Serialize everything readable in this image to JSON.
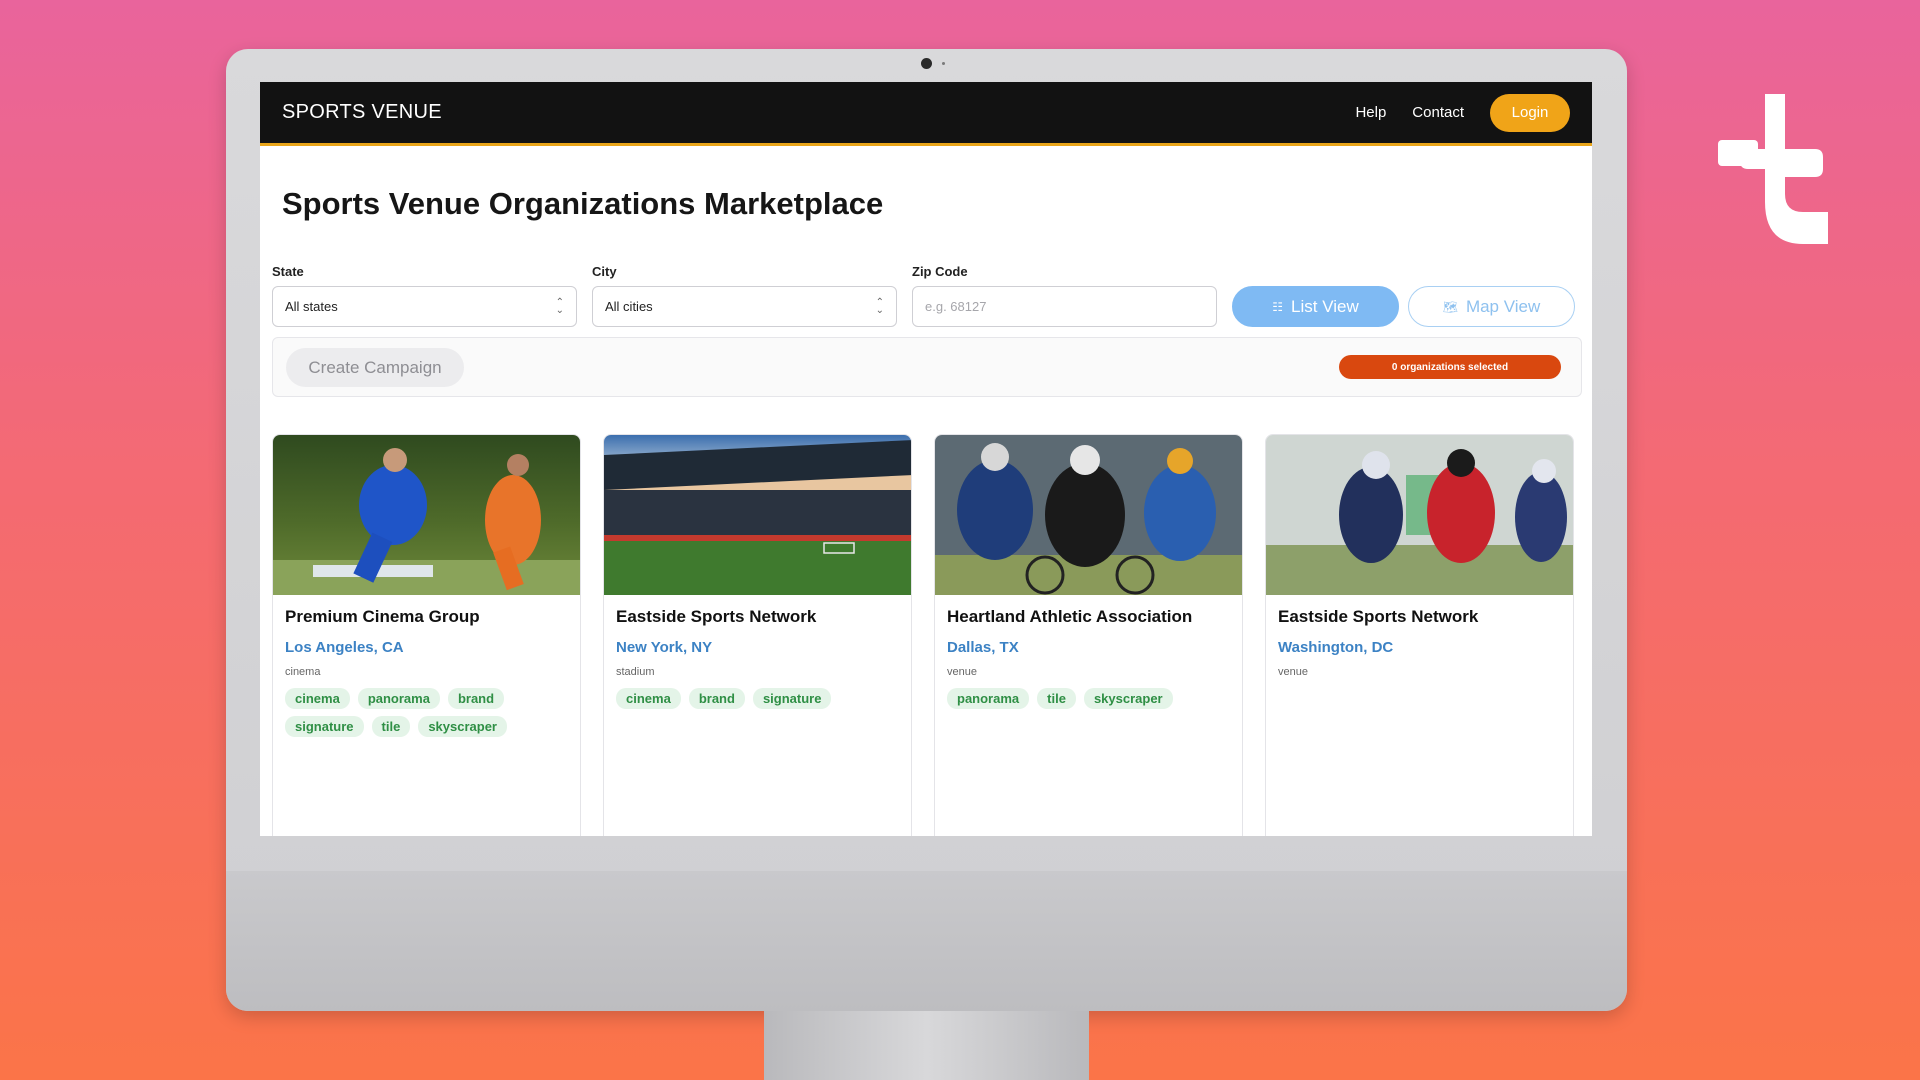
{
  "navbar": {
    "logo": "SPORTS VENUE",
    "links": [
      "Help",
      "Contact"
    ],
    "login": "Login"
  },
  "page": {
    "title": "Sports Venue Organizations Marketplace"
  },
  "filters": {
    "state_label": "State",
    "state_value": "All states",
    "city_label": "City",
    "city_value": "All cities",
    "zip_label": "Zip Code",
    "zip_placeholder": "e.g. 68127",
    "list_view": "List View",
    "map_view": "Map View"
  },
  "campaign": {
    "create_label": "Create Campaign",
    "selected_text": "0 organizations selected"
  },
  "cards": [
    {
      "title": "Premium Cinema Group",
      "location": "Los Angeles, CA",
      "category": "cinema",
      "tags": [
        "cinema",
        "panorama",
        "brand",
        "signature",
        "tile",
        "skyscraper"
      ],
      "image": "soccer-players"
    },
    {
      "title": "Eastside Sports Network",
      "location": "New York, NY",
      "category": "stadium",
      "tags": [
        "cinema",
        "brand",
        "signature"
      ],
      "image": "stadium"
    },
    {
      "title": "Heartland Athletic Association",
      "location": "Dallas, TX",
      "category": "venue",
      "tags": [
        "panorama",
        "tile",
        "skyscraper"
      ],
      "image": "cyclists"
    },
    {
      "title": "Eastside Sports Network",
      "location": "Washington, DC",
      "category": "venue",
      "tags": [],
      "image": "american-football"
    }
  ],
  "colors": {
    "accent": "#f0a418",
    "link": "#3c82c4",
    "badge": "#d9480f",
    "tag_bg": "#e4f4e8",
    "tag_text": "#2f8f45"
  }
}
